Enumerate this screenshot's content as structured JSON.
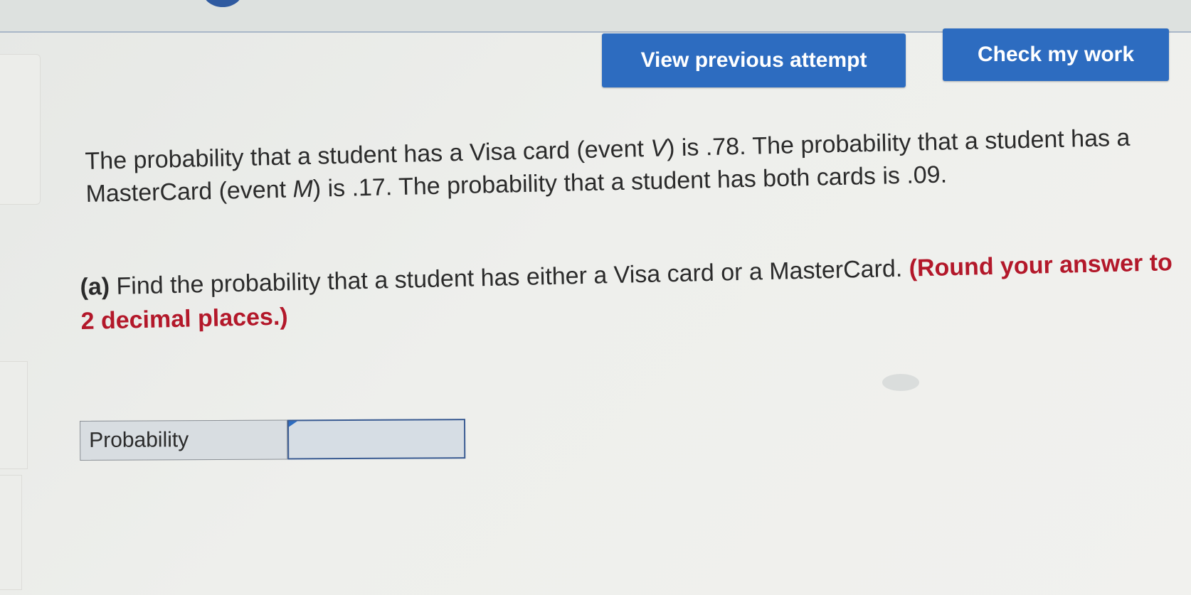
{
  "toolbar": {
    "view_previous_label": "View previous attempt",
    "check_work_label": "Check my work"
  },
  "question": {
    "stem_part1": "The probability that a student has a Visa card (event ",
    "visa_event": "V",
    "stem_part2": ") is .78. The probability that a student has a MasterCard (event ",
    "master_event": "M",
    "stem_part3": ") is .17. The probability that a student has both cards is .09.",
    "part_a_label": "(a)",
    "part_a_text": " Find the probability that a student has either a Visa card or a MasterCard. ",
    "part_a_instruction": "(Round your answer to 2 decimal places.)"
  },
  "answer": {
    "label": "Probability",
    "value": ""
  },
  "colors": {
    "button": "#2d6cc0",
    "instruction": "#b3182a",
    "input_border": "#3a5b92"
  },
  "icons": {
    "input_flag": "flag-icon"
  }
}
